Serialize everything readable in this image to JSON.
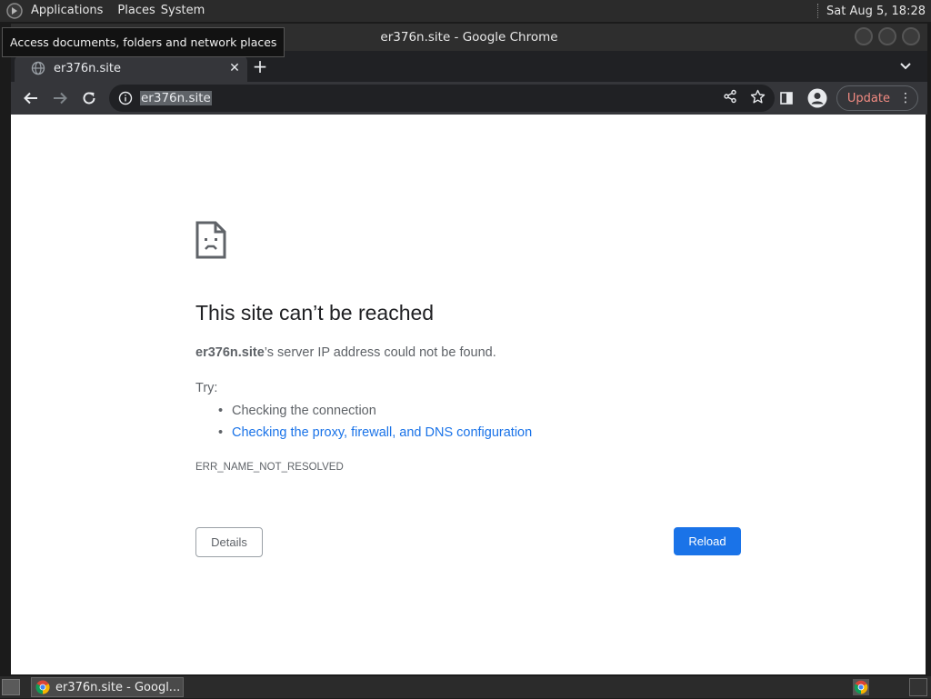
{
  "panel": {
    "menu_applications": "Applications",
    "menu_places": "Places",
    "menu_system": "System",
    "clock": "Sat Aug  5, 18:28"
  },
  "tooltip": {
    "text": "Access documents, folders and network places"
  },
  "window": {
    "title": "er376n.site - Google Chrome"
  },
  "tabs": [
    {
      "title": "er376n.site",
      "icon": "globe-icon"
    }
  ],
  "new_tab_label": "+",
  "toolbar": {
    "url": "er376n.site",
    "update_label": "Update"
  },
  "error_page": {
    "title": "This site can’t be reached",
    "desc_host": "er376n.site",
    "desc_rest": "’s server IP address could not be found.",
    "try_label": "Try:",
    "suggestions": [
      {
        "text": "Checking the connection",
        "link": false
      },
      {
        "text": "Checking the proxy, firewall, and DNS configuration",
        "link": true
      }
    ],
    "error_code": "ERR_NAME_NOT_RESOLVED",
    "details_label": "Details",
    "reload_label": "Reload"
  },
  "taskbar": {
    "task_label": "er376n.site - Googl..."
  },
  "colors": {
    "link": "#1a73e8",
    "reload_bg": "#1a73e8",
    "update_text": "#f28b82"
  }
}
